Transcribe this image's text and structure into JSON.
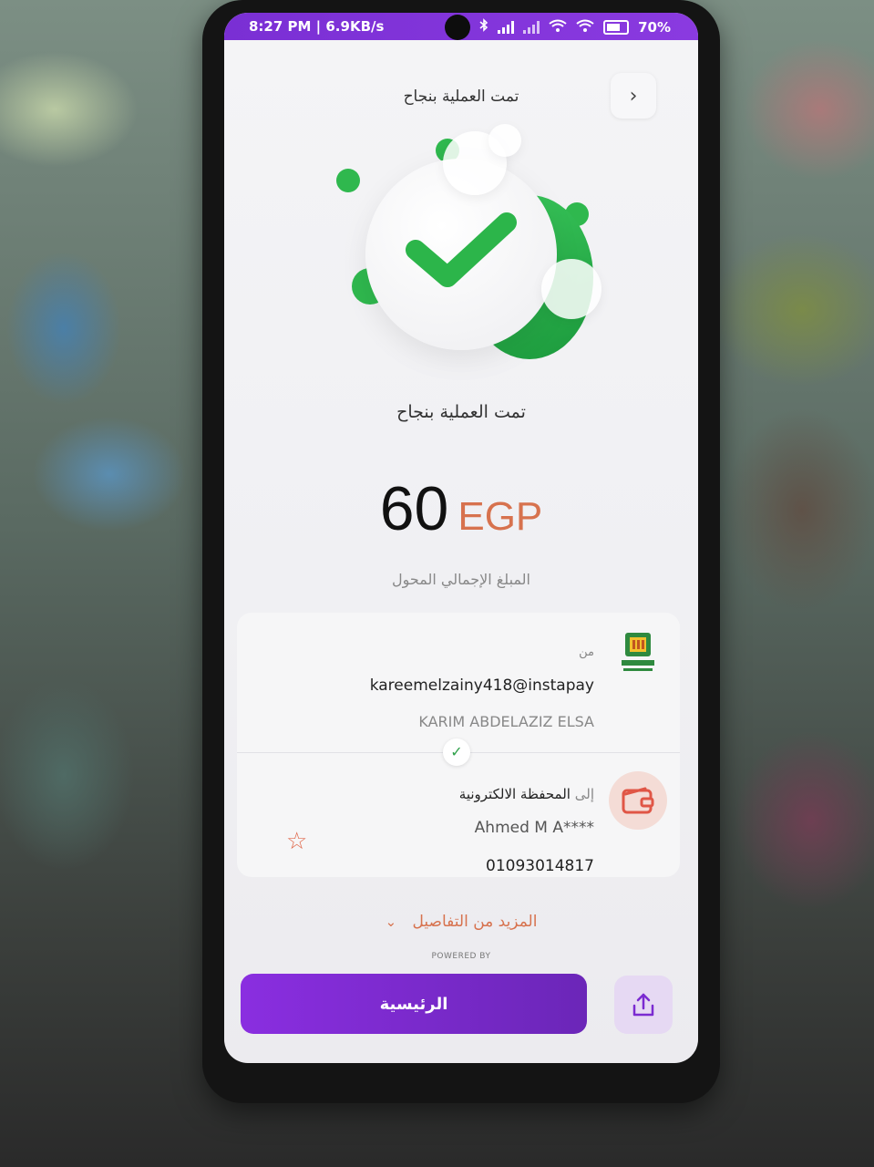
{
  "status_bar": {
    "time_speed": "8:27 PM | 6.9KB/s",
    "battery": "70%",
    "icons": [
      "bluetooth-icon",
      "signal-icon",
      "signal-icon",
      "wifi-icon",
      "wifi-icon",
      "battery-icon"
    ]
  },
  "header": {
    "title": "تمت العملية بنجاح",
    "back_icon": "chevron-right-icon"
  },
  "illustration": {
    "icon": "success-check-icon",
    "accent_color": "#2fb84e"
  },
  "status_text": "تمت العملية بنجاح",
  "amount": {
    "value": "60",
    "currency": "EGP",
    "label": "المبلغ الإجمالي المحول"
  },
  "from": {
    "label": "من",
    "address": "kareemelzainy418@instapay",
    "name": "KARIM ABDELAZIZ ELSA",
    "bank_icon": "bank-logo-icon"
  },
  "to": {
    "prefix": "إلى",
    "type": "المحفظة الالكترونية",
    "name": "Ahmed M A****",
    "phone": "01093014817",
    "wallet_icon": "wallet-icon",
    "favorite_icon": "star-icon"
  },
  "more_details": {
    "label": "المزيد من التفاصيل",
    "icon": "chevron-down-icon"
  },
  "footer": {
    "powered": "POWERED BY",
    "home_button": "الرئيسية",
    "share_icon": "share-icon",
    "brand_color": "#7b2bd1"
  }
}
